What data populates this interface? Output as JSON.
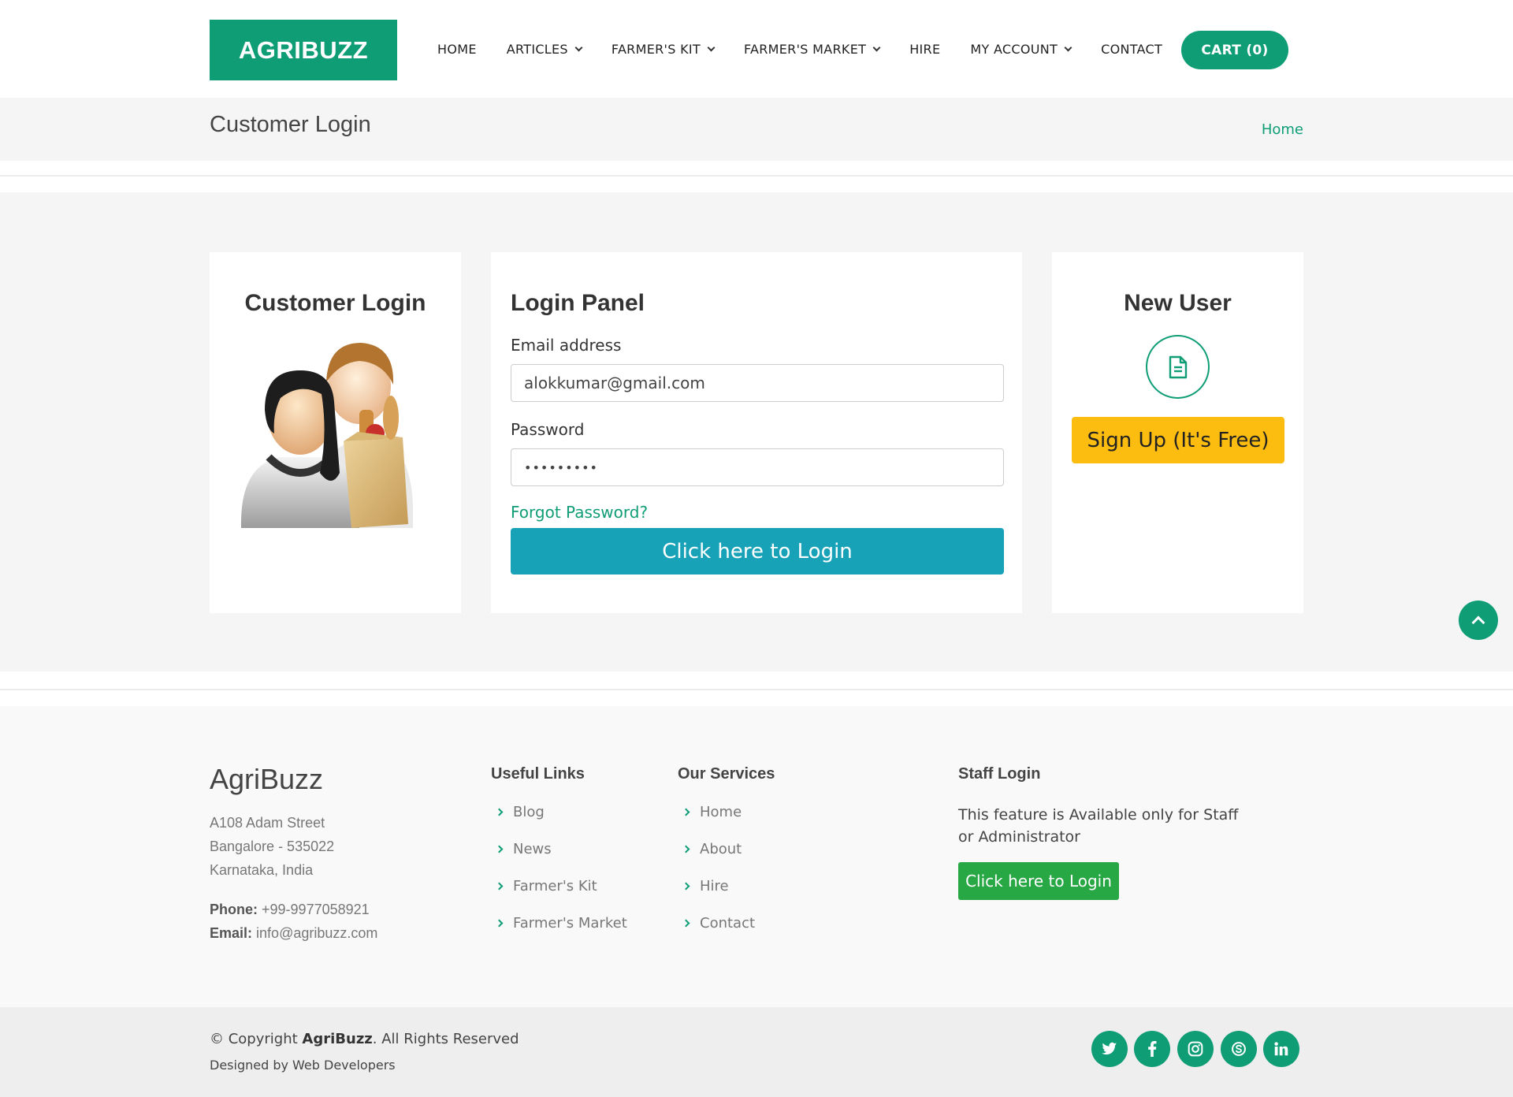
{
  "header": {
    "logo": "AGRIBUZZ",
    "nav": [
      {
        "label": "HOME",
        "dropdown": false
      },
      {
        "label": "ARTICLES",
        "dropdown": true
      },
      {
        "label": "FARMER'S KIT",
        "dropdown": true
      },
      {
        "label": "FARMER'S MARKET",
        "dropdown": true
      },
      {
        "label": "HIRE",
        "dropdown": false
      },
      {
        "label": "MY ACCOUNT",
        "dropdown": true
      },
      {
        "label": "CONTACT",
        "dropdown": false
      }
    ],
    "cart_label": "CART (0)"
  },
  "breadcrumb": {
    "title": "Customer Login",
    "home": "Home"
  },
  "customer_card": {
    "title": "Customer Login"
  },
  "login_panel": {
    "title": "Login Panel",
    "email_label": "Email address",
    "email_value": "alokkumar@gmail.com",
    "password_label": "Password",
    "password_value": "•••••••••",
    "forgot_link": "Forgot Password?",
    "login_button": "Click here to Login"
  },
  "new_user": {
    "title": "New User",
    "icon": "document-icon",
    "signup_button": "Sign Up (It's Free)"
  },
  "footer": {
    "brand": "AgriBuzz",
    "address_lines": [
      "A108 Adam Street",
      "Bangalore - 535022",
      "Karnataka, India"
    ],
    "phone_label": "Phone:",
    "phone": "+99-9977058921",
    "email_label": "Email:",
    "email": "info@agribuzz.com",
    "useful_links": {
      "title": "Useful Links",
      "items": [
        "Blog",
        "News",
        "Farmer's Kit",
        "Farmer's Market"
      ]
    },
    "our_services": {
      "title": "Our Services",
      "items": [
        "Home",
        "About",
        "Hire",
        "Contact"
      ]
    },
    "staff_login": {
      "title": "Staff Login",
      "text": "This feature is Available only for Staff or Administrator",
      "button": "Click here to Login"
    }
  },
  "bottom": {
    "copyright_prefix": "© Copyright",
    "copyright_brand": "AgriBuzz",
    "copyright_suffix": ". All Rights Reserved",
    "designed": "Designed by Web Developers",
    "social": [
      "twitter-icon",
      "facebook-icon",
      "instagram-icon",
      "skype-icon",
      "linkedin-icon"
    ]
  },
  "colors": {
    "brand_green": "#0f9d76",
    "login_teal": "#17a2b8",
    "signup_yellow": "#fcbc10",
    "staff_green": "#28a745"
  }
}
